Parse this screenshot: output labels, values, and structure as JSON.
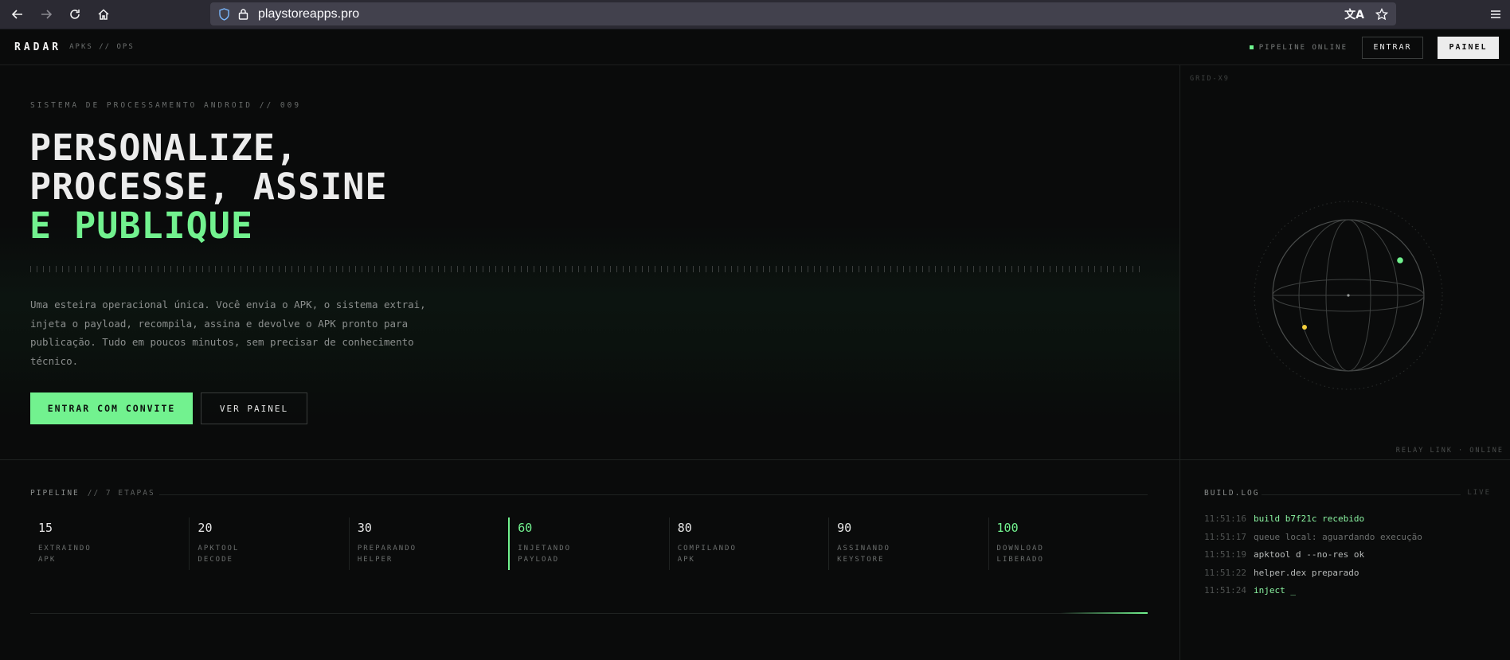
{
  "browser": {
    "url": "playstoreapps.pro",
    "icons": [
      "back-icon",
      "forward-icon",
      "reload-icon",
      "home-icon",
      "shield-icon",
      "lock-icon",
      "translate-icon",
      "bookmark-star-icon",
      "menu-icon"
    ]
  },
  "nav": {
    "logo": "RADAR",
    "logo_sub": "APKS // OPS",
    "status": "PIPELINE ONLINE",
    "login_label": "ENTRAR",
    "panel_label": "PAINEL",
    "status_color": "#72f28f"
  },
  "hero": {
    "eyebrow": "SISTEMA DE PROCESSAMENTO ANDROID // 009",
    "headline_1": "PERSONALIZE,",
    "headline_2": "PROCESSE, ASSINE",
    "headline_3": "E PUBLIQUE",
    "description": "Uma esteira operacional única. Você envia o APK, o sistema extrai, injeta o payload, recompila, assina e devolve o APK pronto para publicação. Tudo em poucos minutos, sem precisar de conhecimento técnico.",
    "cta_primary": "ENTRAR COM CONVITE",
    "cta_secondary": "VER PAINEL",
    "accent_color": "#72f28f"
  },
  "visual": {
    "grid_label": "GRID-X9",
    "relay_label": "RELAY LINK · ONLINE"
  },
  "pipeline": {
    "title": "PIPELINE",
    "subtitle": "// 7 ETAPAS",
    "steps": [
      {
        "num": "15",
        "l1": "EXTRAINDO",
        "l2": "APK"
      },
      {
        "num": "20",
        "l1": "APKTOOL",
        "l2": "DECODE"
      },
      {
        "num": "30",
        "l1": "PREPARANDO",
        "l2": "HELPER"
      },
      {
        "num": "60",
        "l1": "INJETANDO",
        "l2": "PAYLOAD"
      },
      {
        "num": "80",
        "l1": "COMPILANDO",
        "l2": "APK"
      },
      {
        "num": "90",
        "l1": "ASSINANDO",
        "l2": "KEYSTORE"
      },
      {
        "num": "100",
        "l1": "DOWNLOAD",
        "l2": "LIBERADO"
      }
    ]
  },
  "build_log": {
    "title": "BUILD.LOG",
    "live": "LIVE",
    "rows": [
      {
        "time": "11:51:16",
        "msg": "build b7f21c recebido"
      },
      {
        "time": "11:51:17",
        "msg": "queue local: aguardando execução"
      },
      {
        "time": "11:51:19",
        "msg": "apktool d --no-res ok"
      },
      {
        "time": "11:51:22",
        "msg": "helper.dex preparado"
      },
      {
        "time": "11:51:24",
        "msg": "inject _"
      }
    ]
  }
}
